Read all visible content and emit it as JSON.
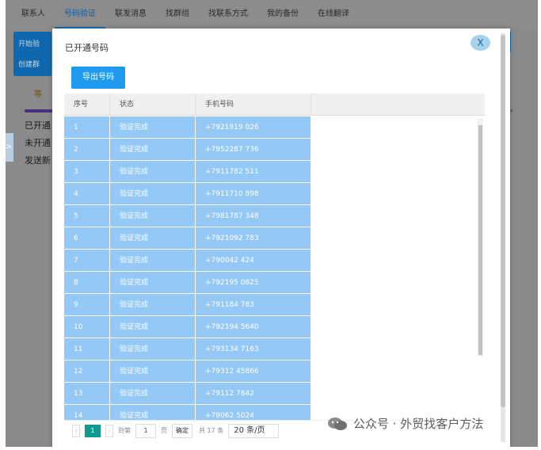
{
  "nav": {
    "items": [
      "联系人",
      "号码验证",
      "联发消息",
      "找群组",
      "找联系方式",
      "我的备份",
      "在线翻译"
    ],
    "active_index": 1
  },
  "background": {
    "panel_line1": "开始验",
    "panel_line2": "创建群",
    "button_label": "等",
    "list_lines": [
      "已开通",
      "未开通",
      "发送新"
    ],
    "collapse_arrow": ">"
  },
  "modal": {
    "title": "已开通号码",
    "close_label": "X",
    "export_button": "导出号码",
    "table": {
      "headers": [
        "序号",
        "状态",
        "手机号码",
        ""
      ],
      "rows": [
        [
          "1",
          "验证完成",
          "+7921919 026"
        ],
        [
          "2",
          "验证完成",
          "+7952287 736"
        ],
        [
          "3",
          "验证完成",
          "+7911782 511"
        ],
        [
          "4",
          "验证完成",
          "+7911710 898"
        ],
        [
          "5",
          "验证完成",
          "+7981787 348"
        ],
        [
          "6",
          "验证完成",
          "+7921092 783"
        ],
        [
          "7",
          "验证完成",
          "+790042 424"
        ],
        [
          "8",
          "验证完成",
          "+792195 0825"
        ],
        [
          "9",
          "验证完成",
          "+791184 783"
        ],
        [
          "10",
          "验证完成",
          "+792194 5640"
        ],
        [
          "11",
          "验证完成",
          "+793134 7163"
        ],
        [
          "12",
          "验证完成",
          "+79312 45866"
        ],
        [
          "13",
          "验证完成",
          "+79112 7842"
        ],
        [
          "14",
          "验证完成",
          "+79062 5024"
        ]
      ]
    },
    "pager": {
      "prev": "‹",
      "current_page": "1",
      "next": "›",
      "goto_label": "到第",
      "goto_value": "1",
      "page_unit": "页",
      "confirm": "确定",
      "total": "共 17 条",
      "page_size": "20 条/页"
    }
  },
  "watermark": {
    "text": "公众号 · 外贸找客户方法"
  },
  "colors": {
    "row_highlight": "#94c9f7",
    "export_button": "#1e9bee",
    "active_page": "#11998e"
  }
}
